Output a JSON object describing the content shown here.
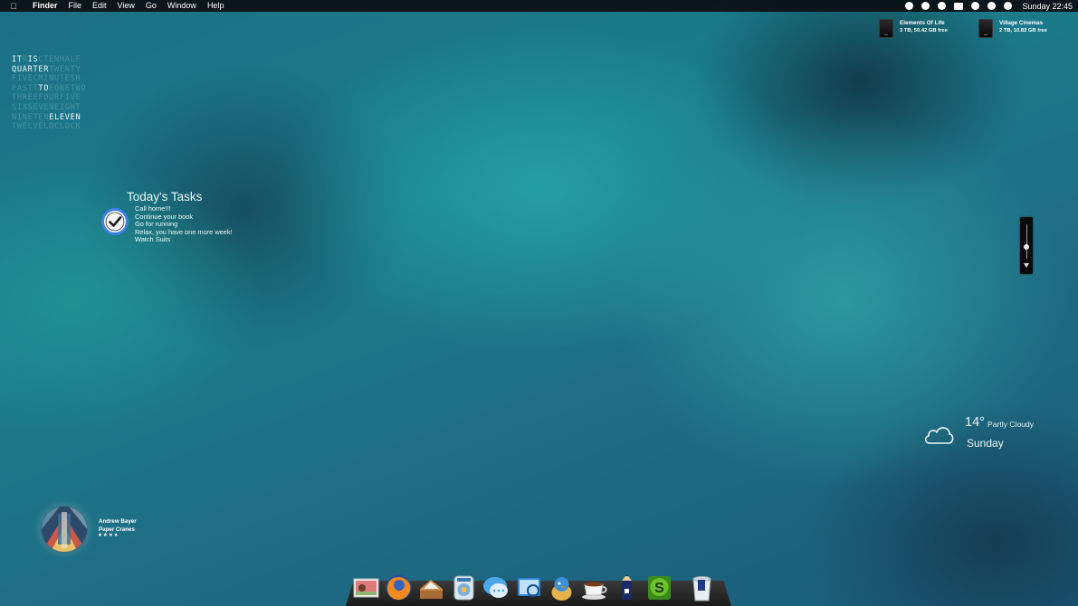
{
  "menubar": {
    "apple_icon": "apple-icon",
    "items": [
      "Finder",
      "File",
      "Edit",
      "View",
      "Go",
      "Window",
      "Help"
    ],
    "status_icons": [
      "sync-icon",
      "parking-icon",
      "circle-icon",
      "display-icon",
      "scripts-icon",
      "clock-icon",
      "wifi-icon"
    ],
    "clock": "Sunday 22:45"
  },
  "word_clock": {
    "lines": [
      [
        {
          "t": "IT",
          "on": true
        },
        {
          "t": "R",
          "on": false
        },
        {
          "t": "IS",
          "on": true
        },
        {
          "t": "CTENHALF",
          "on": false
        }
      ],
      [
        {
          "t": "QUARTER",
          "on": true
        },
        {
          "t": "TWENTY",
          "on": false
        }
      ],
      [
        {
          "t": "FIVECMINUTESH",
          "on": false
        }
      ],
      [
        {
          "t": "PASTT",
          "on": false
        },
        {
          "t": "TO",
          "on": true
        },
        {
          "t": "EONETWO",
          "on": false
        }
      ],
      [
        {
          "t": "THREEFOURFIVE",
          "on": false
        }
      ],
      [
        {
          "t": "SIXSEVENEIGHT",
          "on": false
        }
      ],
      [
        {
          "t": "NINETEN",
          "on": false
        },
        {
          "t": "ELEVEN",
          "on": true
        }
      ],
      [
        {
          "t": "TWELVELOCLOCK",
          "on": false
        }
      ]
    ]
  },
  "tasks": {
    "title": "Today's Tasks",
    "items": [
      "Call home!!!",
      "Continue your book",
      "Go for running",
      "Relax, you have one more week!",
      "Watch Suits"
    ]
  },
  "drives": [
    {
      "name": "Elements Of Life",
      "info": "3 TB, 50.42 GB free"
    },
    {
      "name": "Village Cinemas",
      "info": "2 TB, 10.82 GB free"
    }
  ],
  "volume": {
    "level": 0.35
  },
  "weather": {
    "temp": "14°",
    "condition": "Partly Cloudy",
    "day": "Sunday",
    "icon": "cloud-icon"
  },
  "now_playing": {
    "artist": "Andrew Bayer",
    "title": "Paper Cranes",
    "rating": "★★★★"
  },
  "dock": {
    "items": [
      "photo-icon",
      "firefox-icon",
      "mail-tray-icon",
      "itunes-icon",
      "messages-icon",
      "preview-icon",
      "twitter-bird-icon",
      "coffee-cup-icon",
      "pencil-icon",
      "scrivener-icon",
      "trash-icon"
    ]
  },
  "colors": {
    "accent": "#2a9ba0",
    "menubar": "#0a0e12"
  }
}
